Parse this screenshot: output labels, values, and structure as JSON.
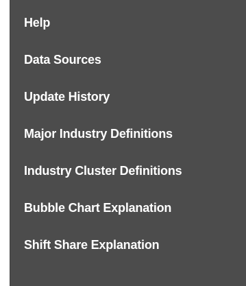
{
  "menu": {
    "items": [
      {
        "label": "Help"
      },
      {
        "label": "Data Sources"
      },
      {
        "label": "Update History"
      },
      {
        "label": "Major Industry Definitions"
      },
      {
        "label": "Industry Cluster Definitions"
      },
      {
        "label": "Bubble Chart Explanation"
      },
      {
        "label": "Shift Share Explanation"
      }
    ]
  },
  "colors": {
    "menu_background": "#4c4c4c",
    "text": "#ffffff",
    "page_background": "#ffffff"
  }
}
